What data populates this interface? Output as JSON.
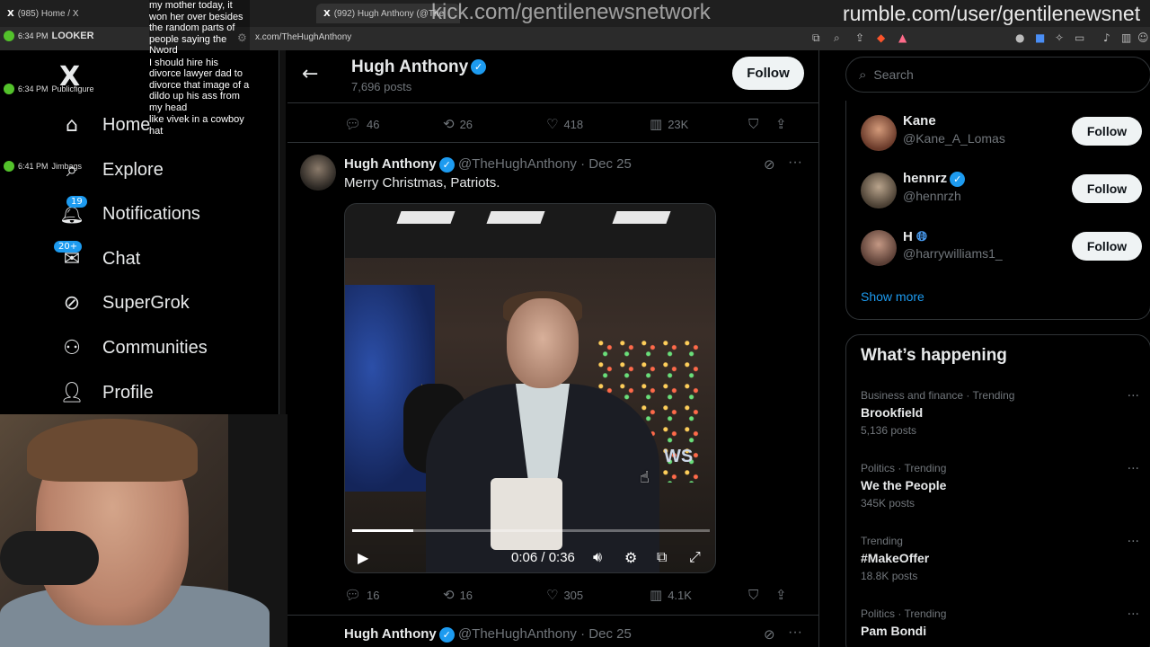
{
  "browser": {
    "tabs": [
      {
        "label": "(985) Home / X"
      },
      {
        "label": "(992) Hugh Anthony (@The"
      }
    ],
    "url": "x.com/TheHughAnthony",
    "overlay_kick": "kick.com/gentilenewsnetwork",
    "overlay_rumble": "rumble.com/user/gentilenewsnet"
  },
  "stream_overlay": {
    "looker_label": "LOOKER",
    "looker_rows": [
      {
        "time": "6:34 PM",
        "user": "LOOKER"
      },
      {
        "time": "6:34 PM",
        "user": "Publicfigure"
      },
      {
        "time": "6:41 PM",
        "user": "Jimbags"
      }
    ],
    "chat_messages": [
      "my mother today, it won her over besides the random parts of people saying the Nword",
      "I should hire his divorce lawyer dad to divorce that image of a dildo up his ass from my head",
      "like vivek in a cowboy hat"
    ]
  },
  "sidebar": {
    "logo": "X",
    "items": [
      {
        "label": "Home",
        "icon": "home-icon",
        "badge": ""
      },
      {
        "label": "Explore",
        "icon": "search-icon",
        "badge": ""
      },
      {
        "label": "Notifications",
        "icon": "bell-icon",
        "badge": "19"
      },
      {
        "label": "Chat",
        "icon": "mail-icon",
        "badge": "20+"
      },
      {
        "label": "SuperGrok",
        "icon": "grok-icon",
        "badge": ""
      },
      {
        "label": "Communities",
        "icon": "people-icon",
        "badge": ""
      },
      {
        "label": "Profile",
        "icon": "person-icon",
        "badge": ""
      }
    ]
  },
  "profile_header": {
    "name": "Hugh Anthony",
    "posts": "7,696 posts",
    "follow_label": "Follow"
  },
  "prev_post_actions": {
    "replies": "46",
    "reposts": "26",
    "likes": "418",
    "views": "23K"
  },
  "post": {
    "author": "Hugh Anthony",
    "handle": "@TheHughAnthony",
    "date": "Dec 25",
    "text": "Merry Christmas, Patriots.",
    "video": {
      "time": "0:06 / 0:36",
      "progress": 0.17,
      "caption": "WS"
    },
    "actions": {
      "replies": "16",
      "reposts": "16",
      "likes": "305",
      "views": "4.1K"
    }
  },
  "next_post": {
    "author": "Hugh Anthony",
    "handle": "@TheHughAnthony",
    "date": "Dec 25"
  },
  "right": {
    "search_placeholder": "Search",
    "who_to_follow": [
      {
        "name": "Kane",
        "handle": "@Kane_A_Lomas",
        "verified": false,
        "follow": "Follow"
      },
      {
        "name": "hennrz",
        "handle": "@hennrzh",
        "verified": true,
        "follow": "Follow"
      },
      {
        "name": "H",
        "handle": "@harrywilliams1_",
        "verified": false,
        "follow": "Follow"
      }
    ],
    "show_more": "Show more",
    "happening_title": "What’s happening",
    "trends": [
      {
        "meta": "Business and finance · Trending",
        "name": "Brookfield",
        "count": "5,136 posts"
      },
      {
        "meta": "Politics · Trending",
        "name": "We the People",
        "count": "345K posts"
      },
      {
        "meta": "Trending",
        "name": "#MakeOffer",
        "count": "18.8K posts"
      },
      {
        "meta": "Politics · Trending",
        "name": "Pam Bondi",
        "count": ""
      }
    ]
  },
  "colors": {
    "accent": "#1d9bf0",
    "background": "#000000",
    "muted": "#71767b"
  }
}
